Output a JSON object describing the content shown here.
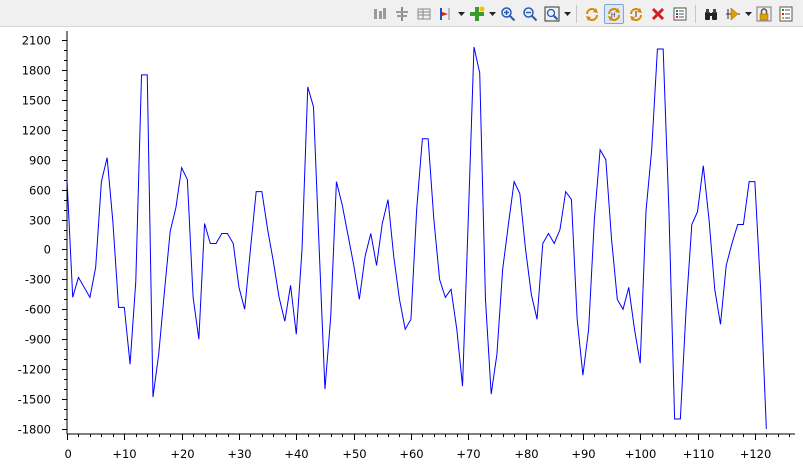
{
  "toolbar": {
    "buttons": [
      {
        "name": "bars-icon",
        "group": 1
      },
      {
        "name": "center-icon",
        "group": 1
      },
      {
        "name": "table-icon",
        "group": 1
      },
      {
        "name": "marker-icon",
        "group": 1,
        "dropdown": true
      },
      {
        "name": "add-plot-icon",
        "group": 1,
        "dropdown": true
      },
      {
        "name": "zoom-in-icon",
        "group": 1
      },
      {
        "name": "zoom-out-icon",
        "group": 1
      },
      {
        "name": "zoom-fit-icon",
        "group": 1,
        "dropdown": true
      },
      {
        "name": "autoscale-icon",
        "group": 2
      },
      {
        "name": "autoscale-xy-icon",
        "group": 2,
        "active": true
      },
      {
        "name": "autoscale-y-icon",
        "group": 2
      },
      {
        "name": "clear-icon",
        "group": 2
      },
      {
        "name": "properties-icon",
        "group": 2
      },
      {
        "name": "binoculars-icon",
        "group": 3
      },
      {
        "name": "cursor-icon",
        "group": 3,
        "dropdown": true
      },
      {
        "name": "lock-icon",
        "group": 3
      },
      {
        "name": "legend-icon",
        "group": 3
      }
    ]
  },
  "chart_data": {
    "type": "line",
    "title": "",
    "xlabel": "",
    "ylabel": "",
    "xlim": [
      0,
      127
    ],
    "ylim": [
      -1850,
      2150
    ],
    "grid": false,
    "legend": "none",
    "y_ticks": [
      2100,
      1800,
      1500,
      1200,
      900,
      600,
      300,
      0,
      -300,
      -600,
      -900,
      -1200,
      -1500,
      -1800
    ],
    "y_tick_labels": [
      "2100",
      "1800",
      "1500",
      "1200",
      "900",
      "600",
      "300",
      "0",
      "-300",
      "-600",
      "-900",
      "-1200",
      "-1500",
      "-1800"
    ],
    "x_ticks": [
      0,
      10,
      20,
      30,
      40,
      50,
      60,
      70,
      80,
      90,
      100,
      110,
      120
    ],
    "x_tick_labels": [
      "0",
      "+10",
      "+20",
      "+30",
      "+40",
      "+50",
      "+60",
      "+70",
      "+80",
      "+90",
      "+100",
      "+110",
      "+120"
    ],
    "series": [
      {
        "color": "#0000ff",
        "values": [
          700,
          -480,
          -280,
          -380,
          -480,
          -180,
          680,
          920,
          280,
          -580,
          -580,
          -1150,
          -320,
          1750,
          1750,
          -1480,
          -1050,
          -420,
          180,
          420,
          820,
          700,
          -480,
          -900,
          260,
          60,
          60,
          160,
          160,
          60,
          -380,
          -600,
          0,
          580,
          580,
          200,
          -120,
          -480,
          -720,
          -360,
          -850,
          0,
          1630,
          1430,
          0,
          -1400,
          -680,
          680,
          450,
          150,
          -150,
          -500,
          -70,
          160,
          -160,
          260,
          500,
          -70,
          -500,
          -800,
          -700,
          400,
          1110,
          1110,
          300,
          -300,
          -480,
          -400,
          -800,
          -1370,
          300,
          2030,
          1770,
          -500,
          -1450,
          -1050,
          -200,
          250,
          680,
          560,
          0,
          -450,
          -700,
          60,
          160,
          60,
          200,
          580,
          500,
          -700,
          -1260,
          -800,
          300,
          1000,
          900,
          100,
          -500,
          -600,
          -380,
          -800,
          -1140,
          380,
          1000,
          2010,
          2010,
          400,
          -1700,
          -1700,
          -600,
          250,
          380,
          840,
          300,
          -400,
          -750,
          -160,
          60,
          250,
          250,
          680,
          680,
          -400,
          -1800
        ]
      }
    ]
  }
}
